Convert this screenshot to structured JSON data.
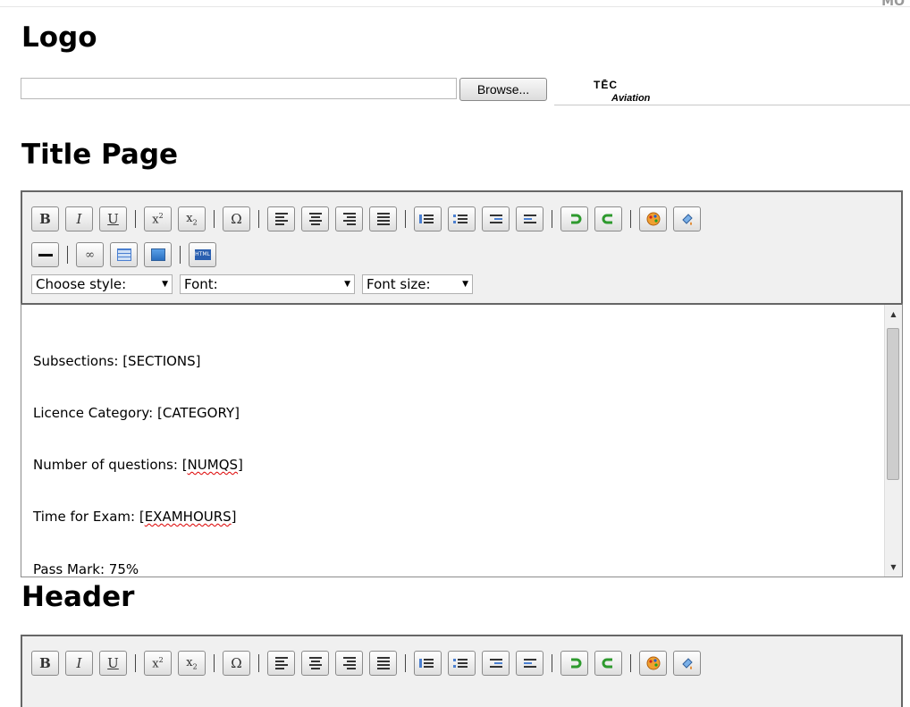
{
  "corner_text": "MO",
  "logo_section": {
    "heading": "Logo",
    "browse_label": "Browse...",
    "logo_text_top": "TĒC",
    "logo_text_bottom": "Aviation"
  },
  "title_page": {
    "heading": "Title Page",
    "style_select": "Choose style:",
    "font_select": "Font:",
    "size_select": "Font size:",
    "lines": [
      "Subsections: [SECTIONS]",
      "Licence Category: [CATEGORY]",
      "Number of questions: [NUMQS]",
      "Time for Exam: [EXAMHOURS]",
      "Pass Mark: 75%"
    ]
  },
  "header_section": {
    "heading": "Header"
  },
  "toolbar_icons": [
    "bold-icon",
    "italic-icon",
    "underline-icon",
    "superscript-icon",
    "subscript-icon",
    "special-char-icon",
    "align-left-icon",
    "align-center-icon",
    "align-right-icon",
    "align-justify-icon",
    "ordered-list-icon",
    "unordered-list-icon",
    "outdent-icon",
    "indent-icon",
    "undo-icon",
    "redo-icon",
    "text-color-icon",
    "background-color-icon",
    "horizontal-rule-icon",
    "link-icon",
    "table-icon",
    "image-icon",
    "html-source-icon"
  ]
}
